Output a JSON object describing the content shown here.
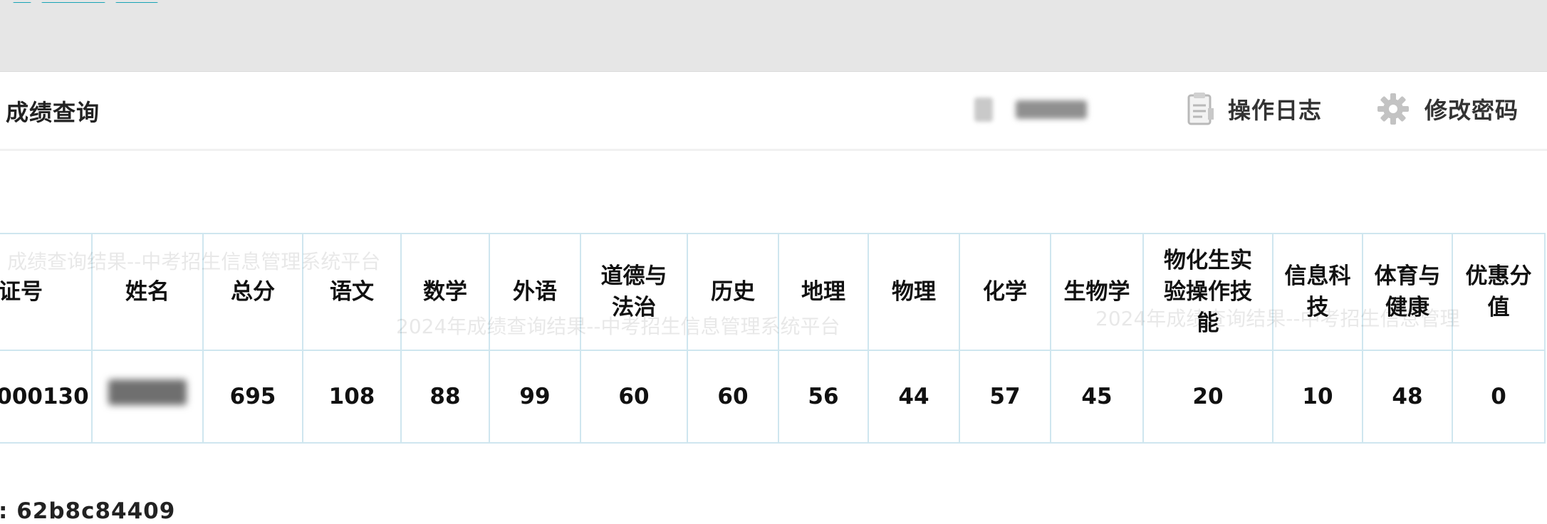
{
  "page": {
    "title": "成绩查询"
  },
  "header": {
    "user": {
      "name_blurred": true
    },
    "op_log_label": "操作日志",
    "change_password_label": "修改密码",
    "icons": {
      "op_log": "document-icon",
      "change_password": "gear-icon"
    }
  },
  "watermarks": [
    {
      "text": "成绩查询结果--中考招生信息管理系统平台"
    },
    {
      "text": "2024年成绩查询结果--中考招生信息管理系统平台"
    },
    {
      "text": "2024年成绩查询结果--中考招生信息管理"
    }
  ],
  "table": {
    "columns": [
      "证号",
      "姓名",
      "总分",
      "语文",
      "数学",
      "外语",
      "道德与法治",
      "历史",
      "地理",
      "物理",
      "化学",
      "生物学",
      "物化生实验操作技能",
      "信息科技",
      "体育与健康",
      "优惠分值"
    ],
    "header_lines": [
      [
        "证号"
      ],
      [
        "姓名"
      ],
      [
        "总分"
      ],
      [
        "语文"
      ],
      [
        "数学"
      ],
      [
        "外语"
      ],
      [
        "道德与",
        "法治"
      ],
      [
        "历史"
      ],
      [
        "地理"
      ],
      [
        "物理"
      ],
      [
        "化学"
      ],
      [
        "生物学"
      ],
      [
        "物化生实",
        "验操作技",
        "能"
      ],
      [
        "信息科",
        "技"
      ],
      [
        "体育与",
        "健康"
      ],
      [
        "优惠分",
        "值"
      ]
    ],
    "row": {
      "id": "000130",
      "name_blurred": true,
      "total": "695",
      "chinese": "108",
      "math": "88",
      "foreign_language": "99",
      "morality_law": "60",
      "history": "60",
      "geography": "56",
      "physics": "44",
      "chemistry": "57",
      "biology": "45",
      "lab_skills": "20",
      "info_tech": "10",
      "pe_health": "48",
      "bonus": "0"
    }
  },
  "footer": {
    "code_text": ": 62b8c84409"
  },
  "colors": {
    "banner_bg": "#e6e6e6",
    "table_border": "#cfe6ef",
    "accent_teal": "#18a3b5"
  }
}
